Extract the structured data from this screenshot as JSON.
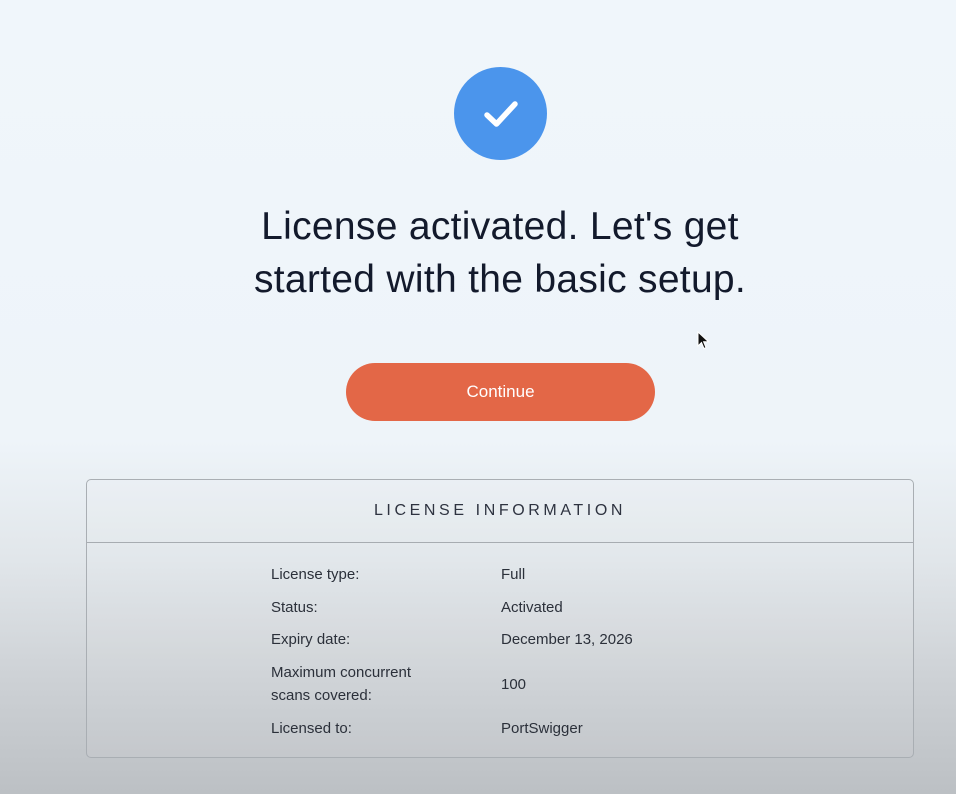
{
  "headline": {
    "line1": "License activated. Let's get",
    "line2": "started with the basic setup."
  },
  "continue_label": "Continue",
  "license_info": {
    "title": "LICENSE INFORMATION",
    "rows": [
      {
        "label": "License type:",
        "value": "Full"
      },
      {
        "label": "Status:",
        "value": "Activated"
      },
      {
        "label": "Expiry date:",
        "value": "December 13, 2026"
      },
      {
        "label": "Maximum concurrent scans covered:",
        "value": "100"
      },
      {
        "label": "Licensed to:",
        "value": "PortSwigger"
      }
    ]
  },
  "colors": {
    "check_circle": "#4b95ec",
    "continue_button": "#e36747"
  },
  "icons": {
    "success": "checkmark-icon",
    "pointer": "mouse-cursor-icon"
  }
}
